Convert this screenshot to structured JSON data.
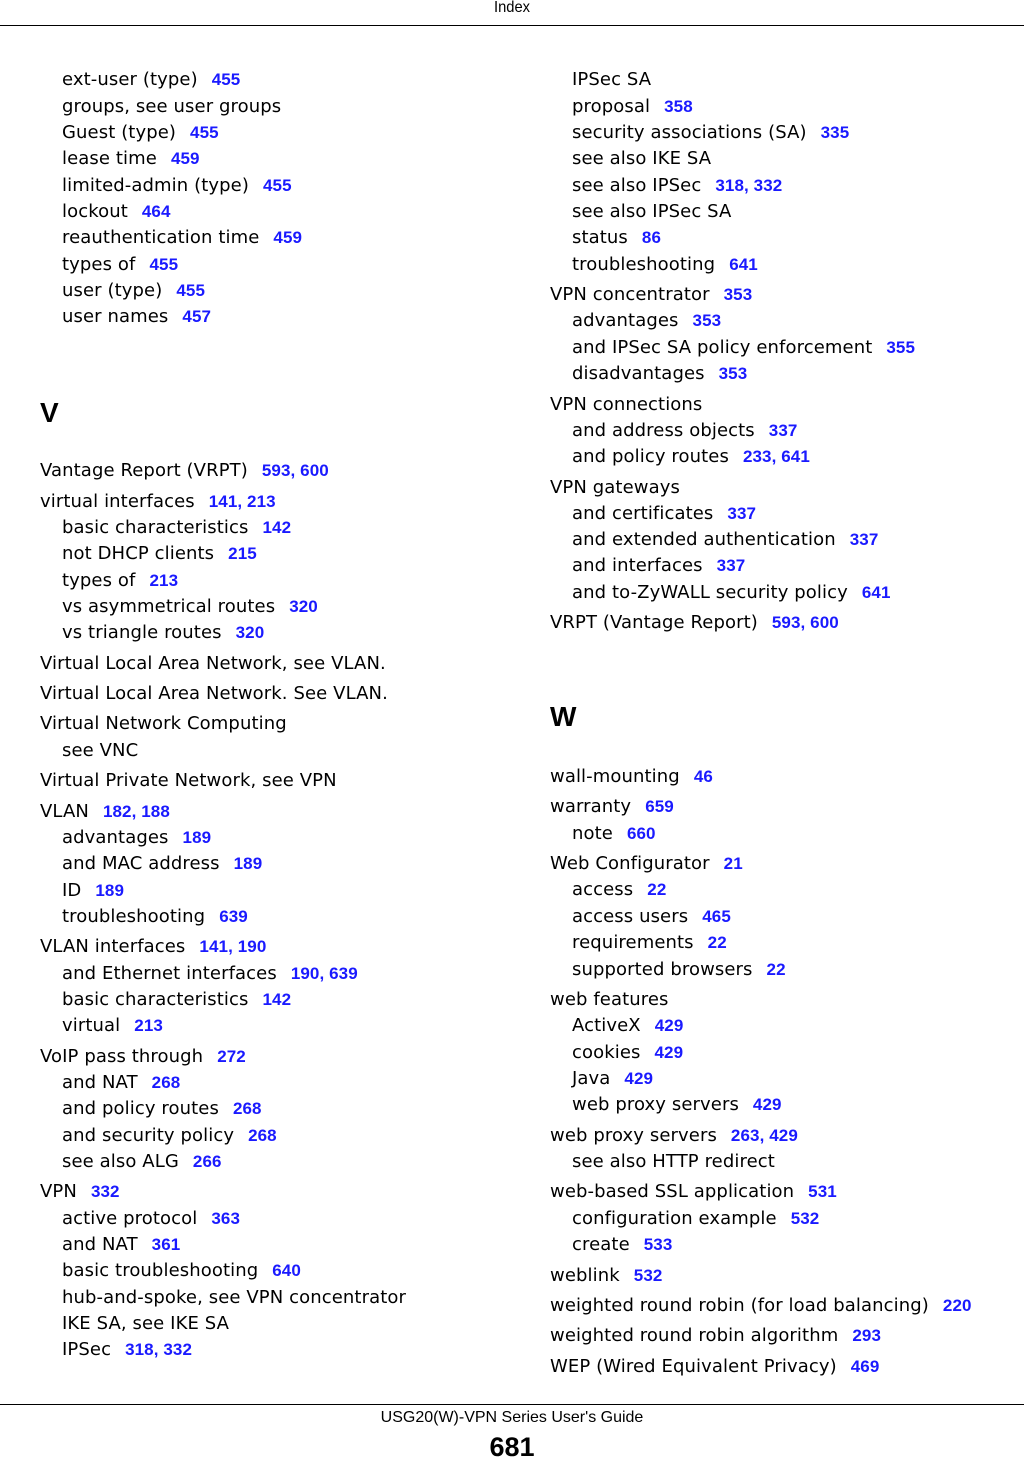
{
  "header": {
    "title": "Index"
  },
  "footer": {
    "guide_title": "USG20(W)-VPN Series User's Guide",
    "page_number": "681"
  },
  "left_column": {
    "entries": [
      {
        "term": "ext-user (type)",
        "pages": "455",
        "level": 2
      },
      {
        "term": "groups, see user groups",
        "pages": "",
        "level": 2
      },
      {
        "term": "Guest (type)",
        "pages": "455",
        "level": 2
      },
      {
        "term": "lease time",
        "pages": "459",
        "level": 2
      },
      {
        "term": "limited-admin (type)",
        "pages": "455",
        "level": 2
      },
      {
        "term": "lockout",
        "pages": "464",
        "level": 2
      },
      {
        "term": "reauthentication time",
        "pages": "459",
        "level": 2
      },
      {
        "term": "types of",
        "pages": "455",
        "level": 2
      },
      {
        "term": "user (type)",
        "pages": "455",
        "level": 2
      },
      {
        "term": "user names",
        "pages": "457",
        "level": 2
      }
    ],
    "section_letter": "V",
    "section_entries": [
      {
        "term": "Vantage Report (VRPT)",
        "pages": "593, 600",
        "level": 1
      },
      {
        "term": "virtual interfaces",
        "pages": "141, 213",
        "level": 1
      },
      {
        "term": "basic characteristics",
        "pages": "142",
        "level": 2
      },
      {
        "term": "not DHCP clients",
        "pages": "215",
        "level": 2
      },
      {
        "term": "types of",
        "pages": "213",
        "level": 2
      },
      {
        "term": "vs asymmetrical routes",
        "pages": "320",
        "level": 2
      },
      {
        "term": "vs triangle routes",
        "pages": "320",
        "level": 2
      },
      {
        "term": "Virtual Local Area Network, see VLAN.",
        "pages": "",
        "level": 1
      },
      {
        "term": "Virtual Local Area Network. See VLAN.",
        "pages": "",
        "level": 1
      },
      {
        "term": "Virtual Network Computing",
        "pages": "",
        "level": 1
      },
      {
        "term": "see VNC",
        "pages": "",
        "level": 2
      },
      {
        "term": "Virtual Private Network, see VPN",
        "pages": "",
        "level": 1
      },
      {
        "term": "VLAN",
        "pages": "182, 188",
        "level": 1
      },
      {
        "term": "advantages",
        "pages": "189",
        "level": 2
      },
      {
        "term": "and MAC address",
        "pages": "189",
        "level": 2
      },
      {
        "term": "ID",
        "pages": "189",
        "level": 2
      },
      {
        "term": "troubleshooting",
        "pages": "639",
        "level": 2
      },
      {
        "term": "VLAN interfaces",
        "pages": "141, 190",
        "level": 1
      },
      {
        "term": "and Ethernet interfaces",
        "pages": "190, 639",
        "level": 2
      },
      {
        "term": "basic characteristics",
        "pages": "142",
        "level": 2
      },
      {
        "term": "virtual",
        "pages": "213",
        "level": 2
      },
      {
        "term": "VoIP pass through",
        "pages": "272",
        "level": 1
      },
      {
        "term": "and NAT",
        "pages": "268",
        "level": 2
      },
      {
        "term": "and policy routes",
        "pages": "268",
        "level": 2
      },
      {
        "term": "and security policy",
        "pages": "268",
        "level": 2
      },
      {
        "term": "see also ALG",
        "pages": "266",
        "level": 2
      },
      {
        "term": "VPN",
        "pages": "332",
        "level": 1
      },
      {
        "term": "active protocol",
        "pages": "363",
        "level": 2
      },
      {
        "term": "and NAT",
        "pages": "361",
        "level": 2
      },
      {
        "term": "basic troubleshooting",
        "pages": "640",
        "level": 2
      },
      {
        "term": "hub-and-spoke, see VPN concentrator",
        "pages": "",
        "level": 2
      },
      {
        "term": "IKE SA, see IKE SA",
        "pages": "",
        "level": 2
      },
      {
        "term": "IPSec",
        "pages": "318, 332",
        "level": 2
      }
    ]
  },
  "right_column": {
    "entries": [
      {
        "term": "IPSec SA",
        "pages": "",
        "level": 2
      },
      {
        "term": "proposal",
        "pages": "358",
        "level": 2
      },
      {
        "term": "security associations (SA)",
        "pages": "335",
        "level": 2
      },
      {
        "term": "see also IKE SA",
        "pages": "",
        "level": 2
      },
      {
        "term": "see also IPSec",
        "pages": "318, 332",
        "level": 2
      },
      {
        "term": "see also IPSec SA",
        "pages": "",
        "level": 2
      },
      {
        "term": "status",
        "pages": "86",
        "level": 2
      },
      {
        "term": "troubleshooting",
        "pages": "641",
        "level": 2
      },
      {
        "term": "VPN concentrator",
        "pages": "353",
        "level": 1
      },
      {
        "term": "advantages",
        "pages": "353",
        "level": 2
      },
      {
        "term": "and IPSec SA policy enforcement",
        "pages": "355",
        "level": 2
      },
      {
        "term": "disadvantages",
        "pages": "353",
        "level": 2
      },
      {
        "term": "VPN connections",
        "pages": "",
        "level": 1
      },
      {
        "term": "and address objects",
        "pages": "337",
        "level": 2
      },
      {
        "term": "and policy routes",
        "pages": "233, 641",
        "level": 2
      },
      {
        "term": "VPN gateways",
        "pages": "",
        "level": 1
      },
      {
        "term": "and certificates",
        "pages": "337",
        "level": 2
      },
      {
        "term": "and extended authentication",
        "pages": "337",
        "level": 2
      },
      {
        "term": "and interfaces",
        "pages": "337",
        "level": 2
      },
      {
        "term": "and to-ZyWALL security policy",
        "pages": "641",
        "level": 2
      },
      {
        "term": "VRPT (Vantage Report)",
        "pages": "593, 600",
        "level": 1
      }
    ],
    "section_letter": "W",
    "section_entries": [
      {
        "term": "wall-mounting",
        "pages": "46",
        "level": 1
      },
      {
        "term": "warranty",
        "pages": "659",
        "level": 1
      },
      {
        "term": "note",
        "pages": "660",
        "level": 2
      },
      {
        "term": "Web Configurator",
        "pages": "21",
        "level": 1
      },
      {
        "term": "access",
        "pages": "22",
        "level": 2
      },
      {
        "term": "access users",
        "pages": "465",
        "level": 2
      },
      {
        "term": "requirements",
        "pages": "22",
        "level": 2
      },
      {
        "term": "supported browsers",
        "pages": "22",
        "level": 2
      },
      {
        "term": "web features",
        "pages": "",
        "level": 1
      },
      {
        "term": "ActiveX",
        "pages": "429",
        "level": 2
      },
      {
        "term": "cookies",
        "pages": "429",
        "level": 2
      },
      {
        "term": "Java",
        "pages": "429",
        "level": 2
      },
      {
        "term": "web proxy servers",
        "pages": "429",
        "level": 2
      },
      {
        "term": "web proxy servers",
        "pages": "263, 429",
        "level": 1
      },
      {
        "term": "see also HTTP redirect",
        "pages": "",
        "level": 2
      },
      {
        "term": "web-based SSL application",
        "pages": "531",
        "level": 1
      },
      {
        "term": "configuration example",
        "pages": "532",
        "level": 2
      },
      {
        "term": "create",
        "pages": "533",
        "level": 2
      },
      {
        "term": "weblink",
        "pages": "532",
        "level": 1
      },
      {
        "term": "weighted round robin (for load balancing)",
        "pages": "220",
        "level": 1
      },
      {
        "term": "weighted round robin algorithm",
        "pages": "293",
        "level": 1
      },
      {
        "term": "WEP (Wired Equivalent Privacy)",
        "pages": "469",
        "level": 1
      }
    ]
  },
  "colors": {
    "page_link": "#1a1aff",
    "text": "#000000"
  }
}
